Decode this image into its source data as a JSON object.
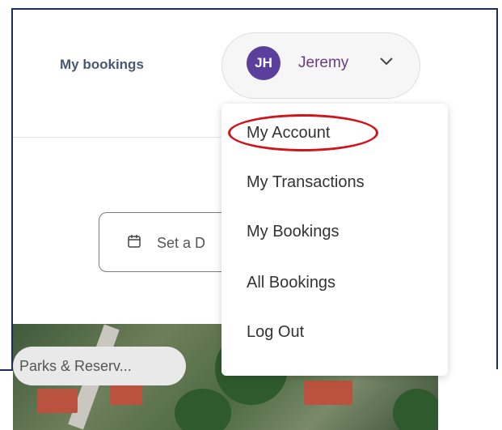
{
  "header": {
    "nav_link": "My bookings",
    "user": {
      "initials": "JH",
      "name": "Jeremy",
      "avatar_color": "#5a3f9c",
      "name_color": "#6b3a86"
    }
  },
  "user_menu": {
    "items": [
      {
        "label": "My Account",
        "highlighted": true
      },
      {
        "label": "My Transactions"
      },
      {
        "label": "My Bookings"
      },
      {
        "label": "All Bookings"
      },
      {
        "label": "Log Out"
      }
    ]
  },
  "filters": {
    "date_value": "Set a D"
  },
  "map": {
    "category_chip": "Parks & Reserv..."
  },
  "colors": {
    "frame_border": "#1f2b5c",
    "highlight_circle": "#d0141c"
  }
}
